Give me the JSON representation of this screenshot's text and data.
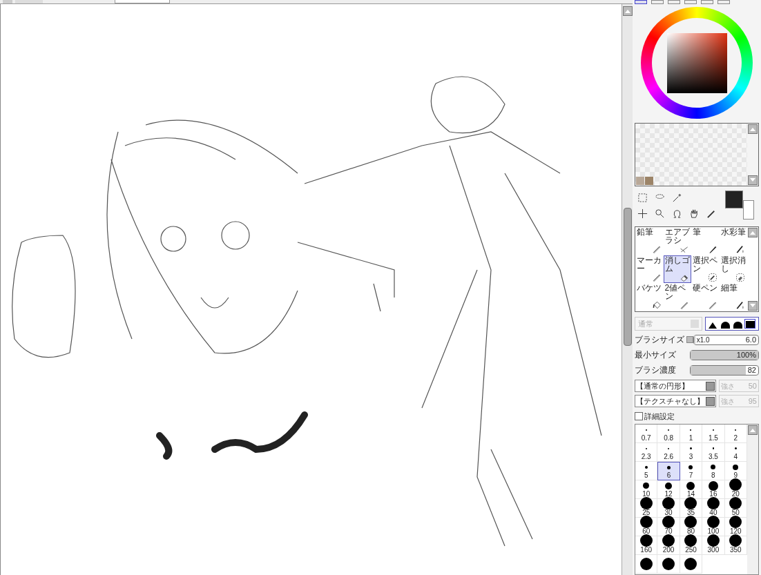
{
  "color_tabs": [
    {
      "selected": true
    },
    {
      "selected": false
    },
    {
      "selected": false
    },
    {
      "selected": false
    },
    {
      "selected": false
    },
    {
      "selected": false
    }
  ],
  "swatches": [
    {
      "color": "#b8a898"
    },
    {
      "color": "#9c8468"
    }
  ],
  "color_boxes": [
    {
      "color": "#222222"
    },
    {
      "color": "#ffffff"
    }
  ],
  "brushes": [
    {
      "label": "鉛筆",
      "kind": "pencil",
      "selected": false
    },
    {
      "label": "エアブラシ",
      "kind": "airbrush",
      "selected": false
    },
    {
      "label": "筆",
      "kind": "brush",
      "selected": false
    },
    {
      "label": "水彩筆",
      "kind": "water",
      "selected": false
    },
    {
      "label": "マーカー",
      "kind": "pencil",
      "selected": false
    },
    {
      "label": "消しゴム",
      "kind": "eraser",
      "selected": true
    },
    {
      "label": "選択ペン",
      "kind": "selpen",
      "selected": false
    },
    {
      "label": "選択消し",
      "kind": "selerase",
      "selected": false
    },
    {
      "label": "バケツ",
      "kind": "bucket",
      "selected": false
    },
    {
      "label": "2値ペン",
      "kind": "pencil",
      "selected": false
    },
    {
      "label": "硬ペン",
      "kind": "pencil",
      "selected": false
    },
    {
      "label": "細筆",
      "kind": "water",
      "selected": false
    }
  ],
  "blend_mode": {
    "value": "通常",
    "disabled": true
  },
  "brush_shapes": [
    {
      "selected": false
    },
    {
      "selected": false
    },
    {
      "selected": false
    },
    {
      "selected": true
    }
  ],
  "sliders": [
    {
      "label": "ブラシサイズ",
      "multiplier": "x1.0",
      "reading": "6.0",
      "level": 0.03
    },
    {
      "label": "最小サイズ",
      "reading": "100%",
      "level": 1
    },
    {
      "label": "ブラシ濃度",
      "reading": "82",
      "level": 0.82
    }
  ],
  "textures": [
    {
      "value": "【通常の円形】",
      "strength_label": "強さ",
      "strength": "50",
      "disabled": true
    },
    {
      "value": "【テクスチャなし】",
      "strength_label": "強さ",
      "strength": "95",
      "disabled": true
    }
  ],
  "advanced": {
    "label": "詳細設定",
    "checked": false
  },
  "size_presets": [
    {
      "label": "0.7",
      "selected": false
    },
    {
      "label": "0.8",
      "selected": false
    },
    {
      "label": "1",
      "selected": false
    },
    {
      "label": "1.5",
      "selected": false
    },
    {
      "label": "2",
      "selected": false
    },
    {
      "label": "2.3",
      "selected": false
    },
    {
      "label": "2.6",
      "selected": false
    },
    {
      "label": "3",
      "selected": false
    },
    {
      "label": "3.5",
      "selected": false
    },
    {
      "label": "4",
      "selected": false
    },
    {
      "label": "5",
      "selected": false
    },
    {
      "label": "6",
      "selected": true
    },
    {
      "label": "7",
      "selected": false
    },
    {
      "label": "8",
      "selected": false
    },
    {
      "label": "9",
      "selected": false
    },
    {
      "label": "10",
      "selected": false
    },
    {
      "label": "12",
      "selected": false
    },
    {
      "label": "14",
      "selected": false
    },
    {
      "label": "16",
      "selected": false
    },
    {
      "label": "20",
      "selected": false
    },
    {
      "label": "25",
      "selected": false
    },
    {
      "label": "30",
      "selected": false
    },
    {
      "label": "35",
      "selected": false
    },
    {
      "label": "40",
      "selected": false
    },
    {
      "label": "50",
      "selected": false
    },
    {
      "label": "60",
      "selected": false
    },
    {
      "label": "70",
      "selected": false
    },
    {
      "label": "80",
      "selected": false
    },
    {
      "label": "100",
      "selected": false
    },
    {
      "label": "120",
      "selected": false
    },
    {
      "label": "160",
      "selected": false
    },
    {
      "label": "200",
      "selected": false
    },
    {
      "label": "250",
      "selected": false
    },
    {
      "label": "300",
      "selected": false
    },
    {
      "label": "350",
      "selected": false
    },
    {
      "selected": false
    },
    {
      "selected": false
    },
    {
      "selected": false
    }
  ]
}
